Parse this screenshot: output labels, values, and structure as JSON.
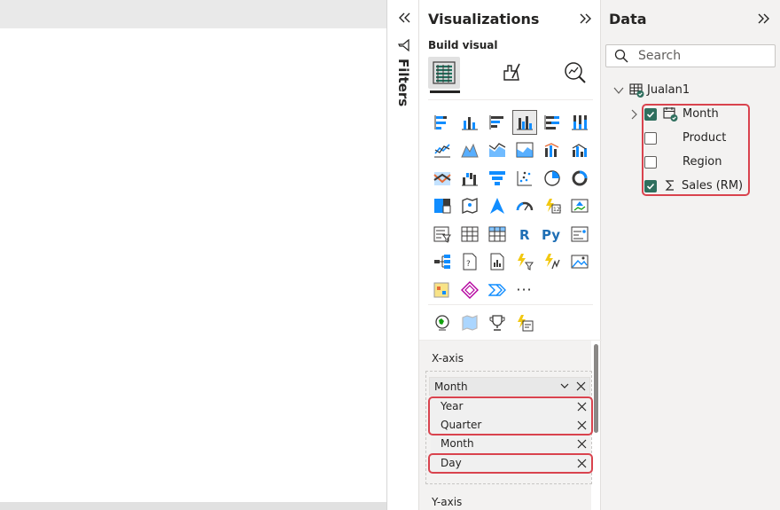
{
  "filters": {
    "label": "Filters"
  },
  "visualizations": {
    "title": "Visualizations",
    "build_label": "Build visual",
    "more_label": "···"
  },
  "wells": {
    "x_axis_label": "X-axis",
    "y_axis_label": "Y-axis",
    "field": {
      "name": "Month"
    },
    "hierarchy": [
      "Year",
      "Quarter",
      "Month",
      "Day"
    ]
  },
  "data": {
    "title": "Data",
    "search_placeholder": "Search",
    "table": "Jualan1",
    "fields": [
      {
        "name": "Month",
        "checked": true
      },
      {
        "name": "Product",
        "checked": false
      },
      {
        "name": "Region",
        "checked": false
      },
      {
        "name": "Sales (RM)",
        "checked": true
      }
    ]
  },
  "colors": {
    "highlight": "#d9434e",
    "check": "#2f6f5e",
    "accent": "#118dff"
  }
}
